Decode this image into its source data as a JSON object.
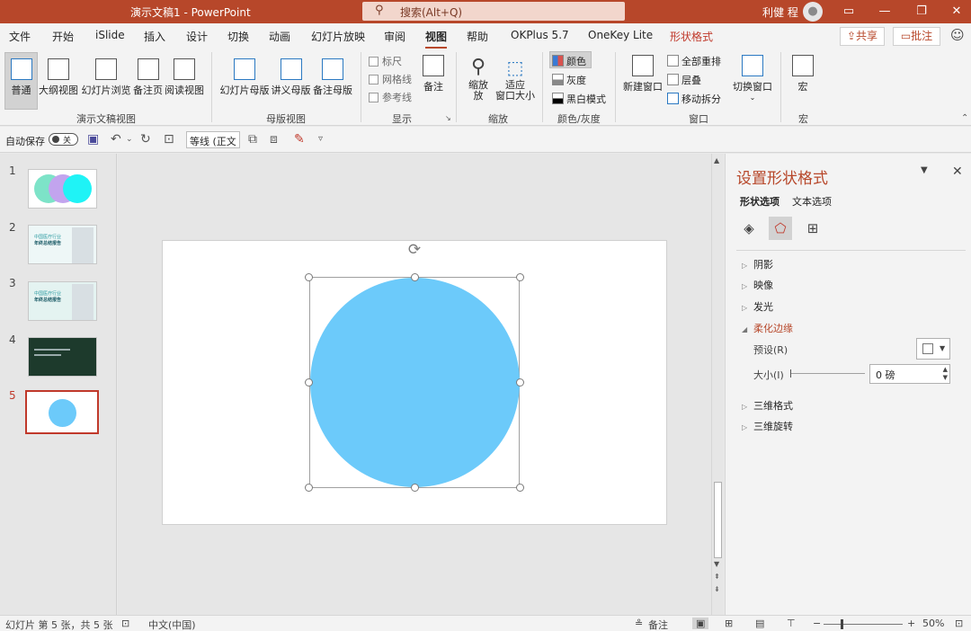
{
  "titlebar": {
    "title": "演示文稿1  -  PowerPoint",
    "search_placeholder": "搜索(Alt+Q)",
    "user": "利健 程",
    "minimize": "—",
    "restore": "❐",
    "close": "✕",
    "ribbon_display": "▭"
  },
  "menu": {
    "tabs": [
      "文件",
      "开始",
      "iSlide",
      "插入",
      "设计",
      "切换",
      "动画",
      "幻灯片放映",
      "审阅",
      "视图",
      "帮助",
      "OKPlus 5.7",
      "OneKey Lite",
      "形状格式"
    ],
    "active": "视图",
    "share": "共享",
    "comment": "批注"
  },
  "ribbon": {
    "presentation_views": [
      "普通",
      "大纲视图",
      "幻灯片浏览",
      "备注页",
      "阅读视图"
    ],
    "presentation_views_label": "演示文稿视图",
    "master_views": [
      "幻灯片母版",
      "讲义母版",
      "备注母版"
    ],
    "master_views_label": "母版视图",
    "show": {
      "ruler": "标尺",
      "gridlines": "网格线",
      "guides": "参考线",
      "notes": "备注",
      "label": "显示"
    },
    "zoom": {
      "zoom": "缩放",
      "zoom2": "放",
      "fit": "适应",
      "fit2": "窗口大小",
      "label": "缩放"
    },
    "color": {
      "color": "颜色",
      "gray": "灰度",
      "bw": "黑白模式",
      "label": "颜色/灰度"
    },
    "window": {
      "new": "新建窗口",
      "arrange": "全部重排",
      "cascade": "层叠",
      "split": "移动拆分",
      "switch": "切换窗口",
      "label": "窗口"
    },
    "macro": {
      "macro": "宏",
      "label": "宏"
    }
  },
  "qat": {
    "autosave": "自动保存",
    "toggle": "关",
    "font": "等线 (正文"
  },
  "slides": [
    {
      "num": "1"
    },
    {
      "num": "2"
    },
    {
      "num": "3"
    },
    {
      "num": "4"
    },
    {
      "num": "5"
    }
  ],
  "thumb_text": {
    "t2_line1": "中国医疗行业",
    "t2_line2": "年终总结报告",
    "t3_line1": "中国医疗行业",
    "t3_line2": "年终总结报告"
  },
  "format_pane": {
    "title": "设置形状格式",
    "tab_shape": "形状选项",
    "tab_text": "文本选项",
    "sections": [
      "阴影",
      "映像",
      "发光",
      "柔化边缘",
      "三维格式",
      "三维旋转"
    ],
    "preset_label": "预设(R)",
    "size_label": "大小(I)",
    "size_value": "0 磅"
  },
  "status": {
    "slide_info": "幻灯片 第 5 张，共 5 张",
    "language": "中文(中国)",
    "notes": "备注",
    "zoom": "50%"
  },
  "colors": {
    "accent": "#b7472a",
    "circle": "#6ccafa"
  }
}
